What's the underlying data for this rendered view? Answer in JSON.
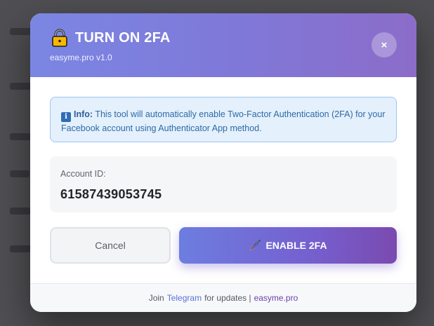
{
  "modal": {
    "title": "TURN ON 2FA",
    "subtitle": "easyme.pro v1.0",
    "close_label": "×",
    "icons": {
      "header": "lock-icon",
      "close": "close-icon",
      "info": "info-icon",
      "enable": "rocket-icon"
    }
  },
  "info": {
    "label": "Info:",
    "text": " This tool will automatically enable Two-Factor Authentication (2FA) for your Facebook account using Authenticator App method."
  },
  "account": {
    "label": "Account ID:",
    "value": "61587439053745"
  },
  "buttons": {
    "cancel": "Cancel",
    "enable": "ENABLE 2FA"
  },
  "footer": {
    "prefix": "Join",
    "link": "Telegram",
    "middle": "for updates |",
    "brand": "easyme.pro"
  },
  "colors": {
    "header_start": "#7b86e3",
    "header_end": "#8c6cc9",
    "info_bg": "#e4f0fc",
    "info_text": "#2c6aa5",
    "enable_start": "#6d7de0",
    "enable_end": "#7a4ab0"
  }
}
